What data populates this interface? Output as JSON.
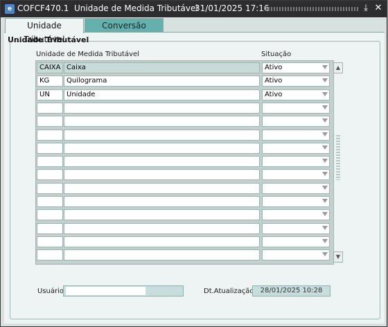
{
  "window": {
    "form_code": "COFCF470.1",
    "title": "Unidade de Medida Tributável",
    "datetime": "31/01/2025 17:16",
    "app_icon_text": "e"
  },
  "tabs": [
    {
      "label": "Unidade Tributável",
      "active": true
    },
    {
      "label": "Conversão",
      "active": false
    }
  ],
  "section": {
    "title": "Unidade Tributável",
    "col_unit": "Unidade de Medida Tributável",
    "col_status": "Situação"
  },
  "rows": [
    {
      "code": "CAIXA",
      "desc": "Caixa",
      "status": "Ativo"
    },
    {
      "code": "KG",
      "desc": "Quilograma",
      "status": "Ativo"
    },
    {
      "code": "UN",
      "desc": "Unidade",
      "status": "Ativo"
    },
    {
      "code": "",
      "desc": "",
      "status": ""
    },
    {
      "code": "",
      "desc": "",
      "status": ""
    },
    {
      "code": "",
      "desc": "",
      "status": ""
    },
    {
      "code": "",
      "desc": "",
      "status": ""
    },
    {
      "code": "",
      "desc": "",
      "status": ""
    },
    {
      "code": "",
      "desc": "",
      "status": ""
    },
    {
      "code": "",
      "desc": "",
      "status": ""
    },
    {
      "code": "",
      "desc": "",
      "status": ""
    },
    {
      "code": "",
      "desc": "",
      "status": ""
    },
    {
      "code": "",
      "desc": "",
      "status": ""
    },
    {
      "code": "",
      "desc": "",
      "status": ""
    },
    {
      "code": "",
      "desc": "",
      "status": ""
    }
  ],
  "footer": {
    "user_label": "Usuário",
    "user_value": "",
    "update_label": "Dt.Atualização",
    "update_value": "28/01/2025 10:28"
  }
}
